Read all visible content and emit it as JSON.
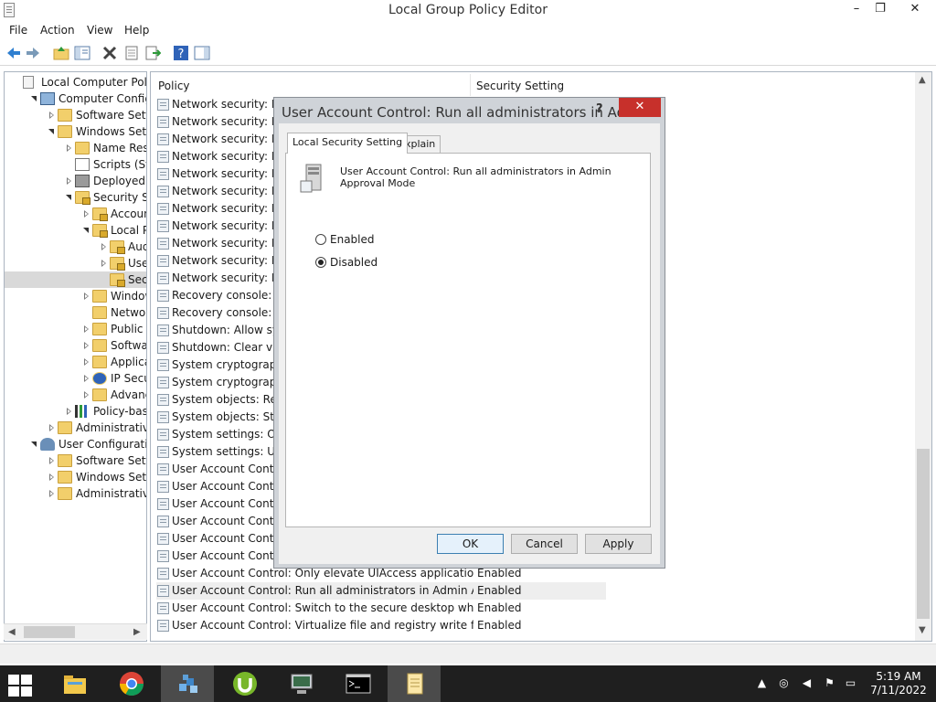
{
  "window": {
    "title": "Local Group Policy Editor",
    "minimize": "–",
    "maximize": "❐",
    "close": "✕"
  },
  "menu": [
    "File",
    "Action",
    "View",
    "Help"
  ],
  "tree": {
    "nodes": [
      {
        "label": "Local Computer Policy"
      },
      {
        "label": "Computer Configura"
      },
      {
        "label": "Software Settings"
      },
      {
        "label": "Windows Setting"
      },
      {
        "label": "Name Resolu"
      },
      {
        "label": "Scripts (Startu"
      },
      {
        "label": "Deployed Prir"
      },
      {
        "label": "Security Settir"
      },
      {
        "label": "Account P"
      },
      {
        "label": "Local Poli"
      },
      {
        "label": "Audit"
      },
      {
        "label": "User R"
      },
      {
        "label": "Securi"
      },
      {
        "label": "Windows"
      },
      {
        "label": "Network L"
      },
      {
        "label": "Public Key"
      },
      {
        "label": "Software F"
      },
      {
        "label": "Applicatic"
      },
      {
        "label": "IP Security"
      },
      {
        "label": "Advanced"
      },
      {
        "label": "Policy-based"
      },
      {
        "label": "Administrative Te"
      },
      {
        "label": "User Configuration"
      },
      {
        "label": "Software Settings"
      },
      {
        "label": "Windows Setting"
      },
      {
        "label": "Administrative Te"
      }
    ]
  },
  "list": {
    "col_policy": "Policy",
    "col_setting": "Security Setting",
    "rows": [
      {
        "name": "Network security: LA",
        "value": ""
      },
      {
        "name": "Network security: LD",
        "value": ""
      },
      {
        "name": "Network security: Mi",
        "value": ""
      },
      {
        "name": "Network security: Mi",
        "value": ""
      },
      {
        "name": "Network security: Res",
        "value": ""
      },
      {
        "name": "Network security: Res",
        "value": ""
      },
      {
        "name": "Network security: Res",
        "value": ""
      },
      {
        "name": "Network security: Res",
        "value": ""
      },
      {
        "name": "Network security: Res",
        "value": ""
      },
      {
        "name": "Network security: Res",
        "value": ""
      },
      {
        "name": "Network security: Res",
        "value": ""
      },
      {
        "name": "Recovery console: Al",
        "value": ""
      },
      {
        "name": "Recovery console: Al",
        "value": ""
      },
      {
        "name": "Shutdown: Allow syst",
        "value": ""
      },
      {
        "name": "Shutdown: Clear virtu",
        "value": ""
      },
      {
        "name": "System cryptography",
        "value": ""
      },
      {
        "name": "System cryptography",
        "value": ""
      },
      {
        "name": "System objects: Requ",
        "value": ""
      },
      {
        "name": "System objects: Stren",
        "value": ""
      },
      {
        "name": "System settings: Opti",
        "value": ""
      },
      {
        "name": "System settings: Use",
        "value": ""
      },
      {
        "name": "User Account Control",
        "value": ""
      },
      {
        "name": "User Account Contro",
        "value": ""
      },
      {
        "name": "User Account Contro",
        "value": ""
      },
      {
        "name": "User Account Contro",
        "value": ""
      },
      {
        "name": "User Account Contro",
        "value": ""
      },
      {
        "name": "User Account Contro",
        "value": ""
      },
      {
        "name": "User Account Control: Only elevate UIAccess applications th...",
        "value": "Enabled"
      },
      {
        "name": "User Account Control: Run all administrators in Admin Appr...",
        "value": "Enabled"
      },
      {
        "name": "User Account Control: Switch to the secure desktop when pr...",
        "value": "Enabled"
      },
      {
        "name": "User Account Control: Virtualize file and registry write failure...",
        "value": "Enabled"
      }
    ]
  },
  "dialog": {
    "title": "User Account Control: Run all administrators in Ad...",
    "help": "?",
    "close": "✕",
    "tabs": [
      "Local Security Setting",
      "Explain"
    ],
    "policy_text": "User Account Control: Run all administrators in Admin Approval Mode",
    "options": [
      "Enabled",
      "Disabled"
    ],
    "selected_option": "Disabled",
    "buttons": {
      "ok": "OK",
      "cancel": "Cancel",
      "apply": "Apply"
    }
  },
  "taskbar": {
    "tray_chevron": "▲",
    "clock_time": "5:19 AM",
    "clock_date": "7/11/2022"
  }
}
